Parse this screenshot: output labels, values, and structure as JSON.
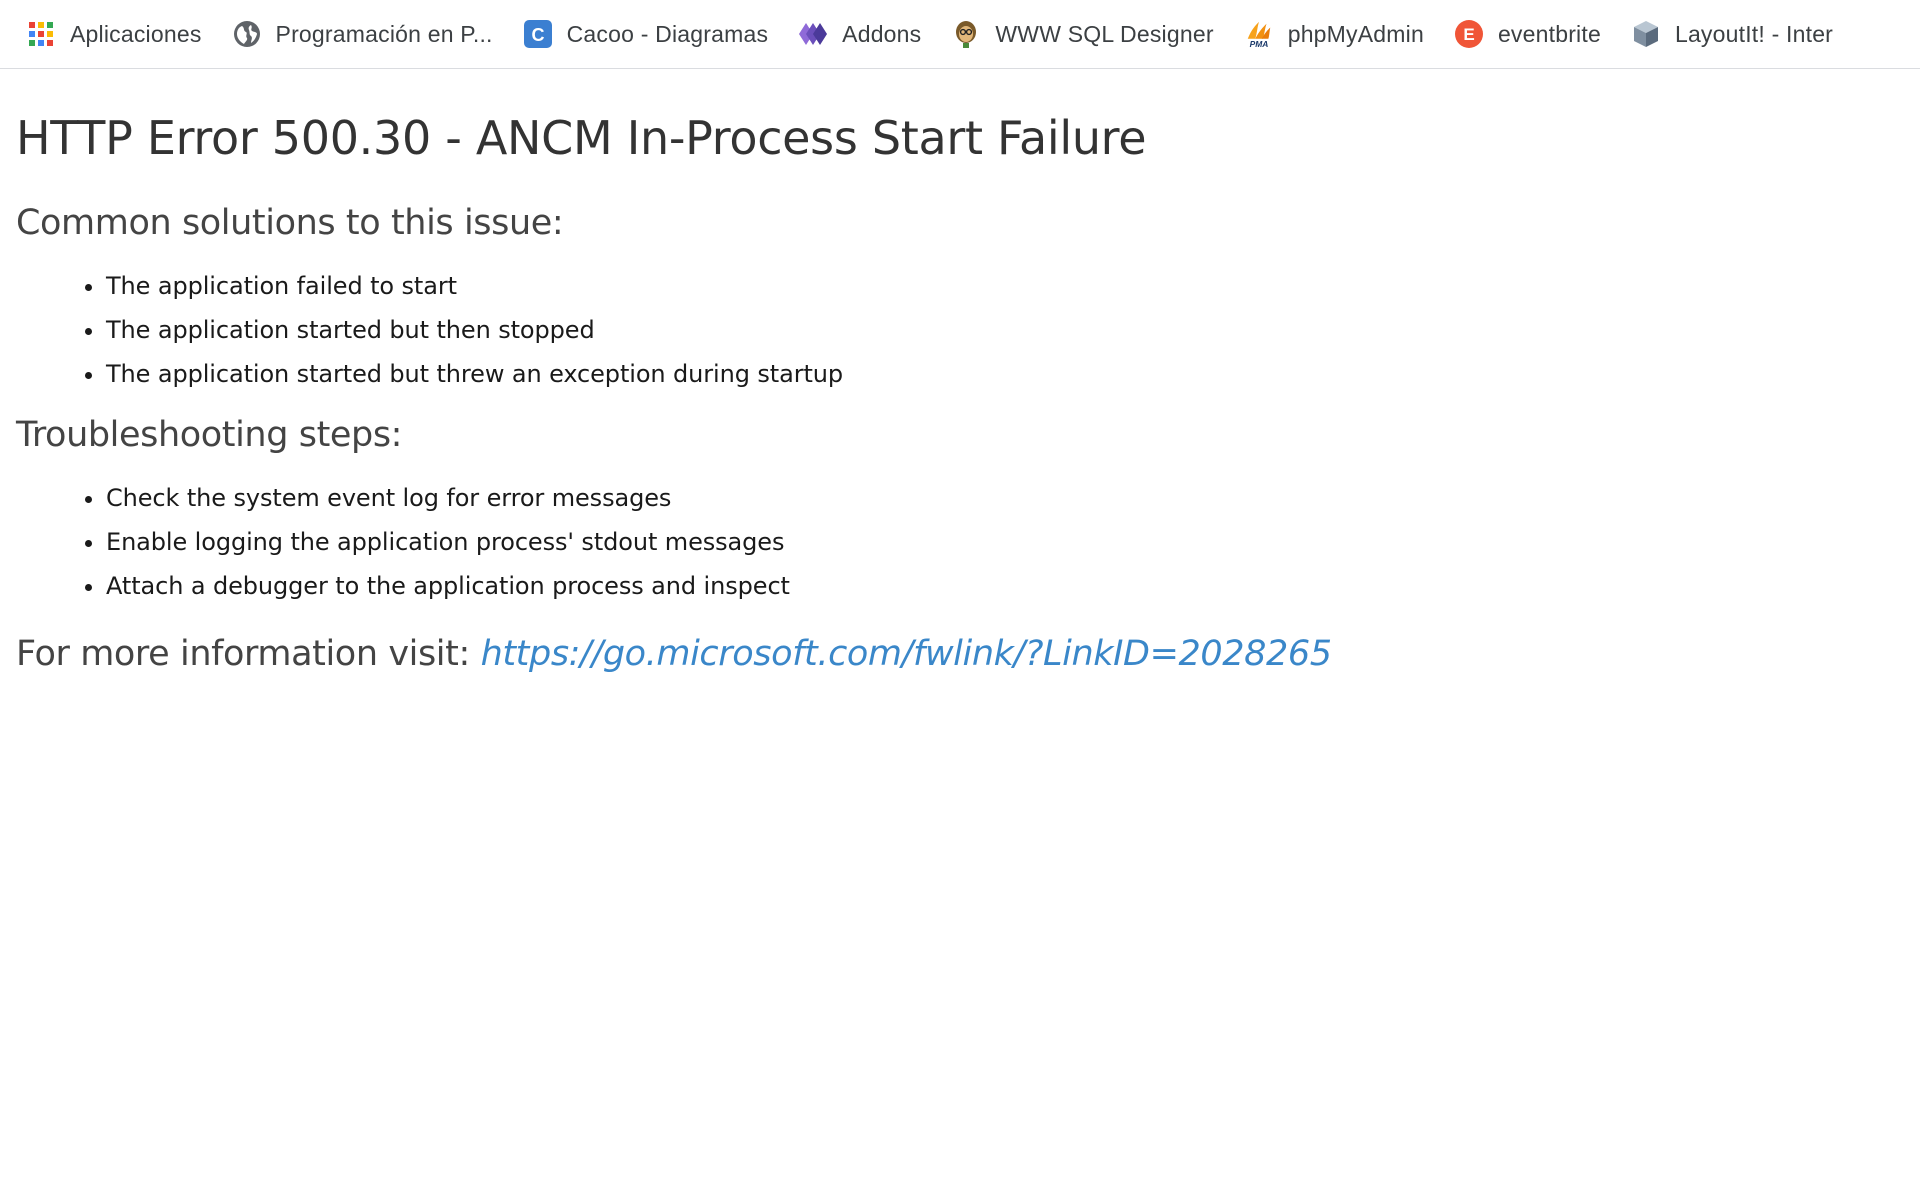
{
  "bookmarks": [
    {
      "label": "Aplicaciones",
      "icon": "apps-grid-icon"
    },
    {
      "label": "Programación en P...",
      "icon": "globe-icon"
    },
    {
      "label": "Cacoo - Diagramas",
      "icon": "cacoo-icon"
    },
    {
      "label": "Addons",
      "icon": "addons-icon"
    },
    {
      "label": "WWW SQL Designer",
      "icon": "sql-designer-icon"
    },
    {
      "label": "phpMyAdmin",
      "icon": "phpmyadmin-icon"
    },
    {
      "label": "eventbrite",
      "icon": "eventbrite-icon"
    },
    {
      "label": "LayoutIt! - Inter",
      "icon": "layoutit-icon"
    }
  ],
  "icon_text": {
    "cacoo": "C",
    "phpmyadmin": "PMA",
    "eventbrite": "E"
  },
  "page": {
    "title": "HTTP Error 500.30 - ANCM In-Process Start Failure",
    "common_heading": "Common solutions to this issue:",
    "common_items": [
      "The application failed to start",
      "The application started but then stopped",
      "The application started but threw an exception during startup"
    ],
    "troubleshooting_heading": "Troubleshooting steps:",
    "troubleshooting_items": [
      "Check the system event log for error messages",
      "Enable logging the application process' stdout messages",
      "Attach a debugger to the application process and inspect"
    ],
    "more_info_label": "For more information visit: ",
    "more_info_link": "https://go.microsoft.com/fwlink/?LinkID=2028265"
  },
  "colors": {
    "link": "#3a87c9",
    "heading": "#444444",
    "cacoo_blue": "#3b7fd1",
    "addons_purple": "#6b4fbb",
    "eventbrite_orange": "#f05537"
  }
}
